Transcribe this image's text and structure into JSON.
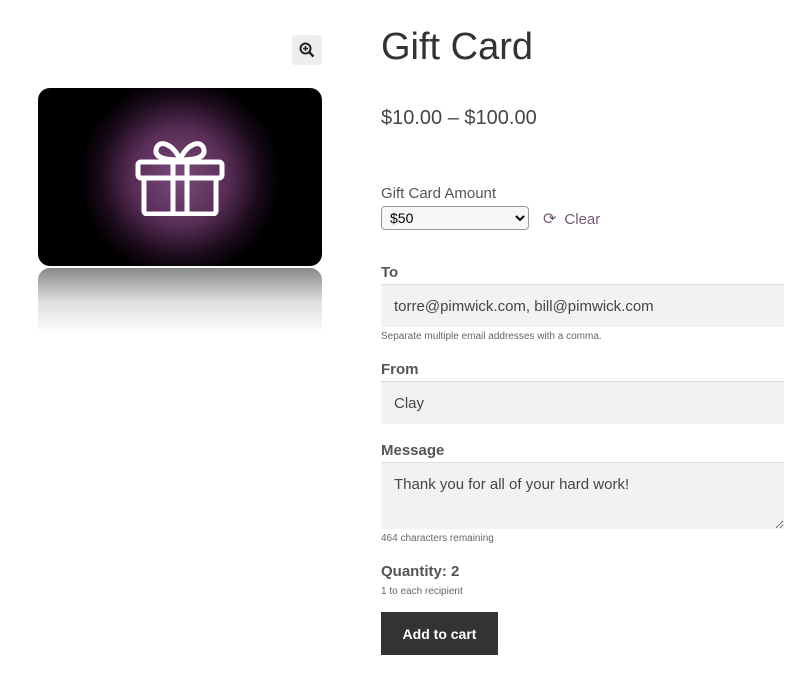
{
  "product": {
    "title": "Gift Card",
    "price": "$10.00 – $100.00",
    "image_alt": "Gift card image"
  },
  "amount": {
    "label": "Gift Card Amount",
    "selected": "$50",
    "clear_label": "Clear"
  },
  "to": {
    "label": "To",
    "value": "torre@pimwick.com, bill@pimwick.com",
    "help": "Separate multiple email addresses with a comma."
  },
  "from": {
    "label": "From",
    "value": "Clay"
  },
  "message": {
    "label": "Message",
    "value": "Thank you for all of your hard work!",
    "help": "464 characters remaining"
  },
  "quantity": {
    "label": "Quantity: 2",
    "help": "1 to each recipient"
  },
  "cart": {
    "label": "Add to cart"
  },
  "colors": {
    "accent": "#7a5775",
    "button": "#333333"
  }
}
